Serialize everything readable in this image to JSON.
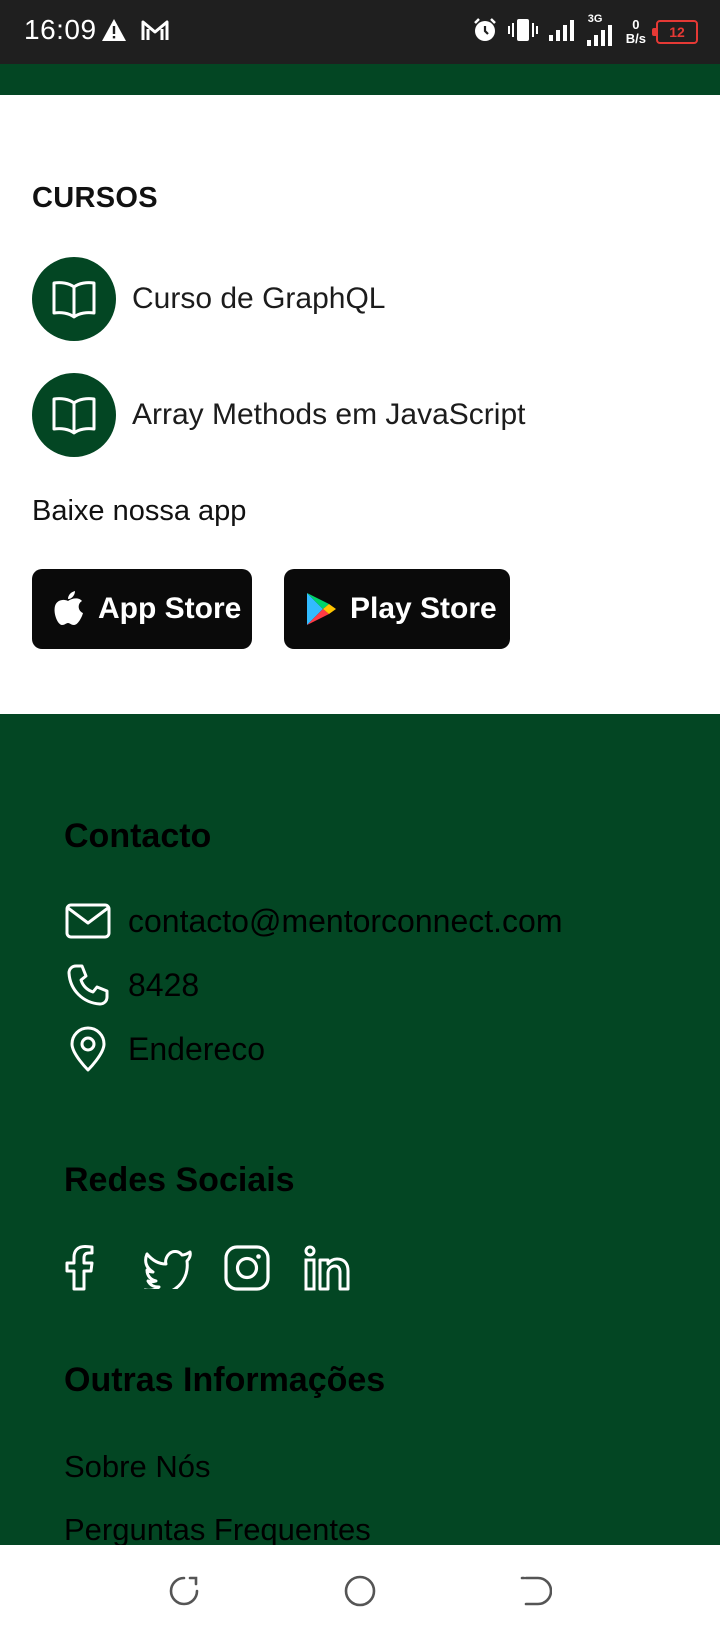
{
  "status_bar": {
    "time": "16:09",
    "network_type": "3G",
    "data_speed_value": "0",
    "data_speed_unit": "B/s",
    "battery": "12",
    "icons": [
      "warning-icon",
      "gmail-icon",
      "alarm-icon",
      "vibrate-icon",
      "signal-icon",
      "signal-3g-icon",
      "battery-icon"
    ]
  },
  "courses": {
    "title": "CURSOS",
    "items": [
      {
        "label": "Curso de GraphQL",
        "icon": "book-icon"
      },
      {
        "label": "Array Methods em JavaScript",
        "icon": "book-icon"
      }
    ]
  },
  "app_download": {
    "title": "Baixe nossa app",
    "app_store_label": "App Store",
    "play_store_label": "Play Store"
  },
  "footer": {
    "contact": {
      "title": "Contacto",
      "email": "contacto@mentorconnect.com",
      "phone": "8428",
      "address": "Endereco"
    },
    "social": {
      "title": "Redes Sociais",
      "icons": [
        "facebook-icon",
        "twitter-icon",
        "instagram-icon",
        "linkedin-icon"
      ]
    },
    "other_info": {
      "title": "Outras Informações",
      "links": [
        "Sobre Nós",
        "Perguntas Frequentes"
      ]
    }
  },
  "nav_bar": {
    "buttons": [
      "recents-button",
      "home-button",
      "back-button"
    ]
  },
  "colors": {
    "brand_green": "#034623",
    "status_bar_bg": "#1f1f1f",
    "store_button_bg": "#0a0a0a",
    "battery_low": "#e53935"
  }
}
